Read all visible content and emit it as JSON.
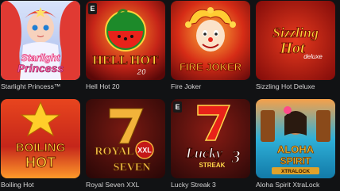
{
  "games": [
    {
      "id": "starlight-princess",
      "title": "Starlight Princess™",
      "art_text": [
        "Starlight",
        "Princess"
      ],
      "colors": {
        "bg": "#b9c9ef",
        "accent": "#e8357a"
      }
    },
    {
      "id": "hell-hot-20",
      "title": "Hell Hot 20",
      "art_text": [
        "HELL HOT",
        "20"
      ],
      "badge": "E",
      "colors": {
        "bg": "#c62518",
        "accent": "#ffd23a"
      }
    },
    {
      "id": "fire-joker",
      "title": "Fire Joker",
      "art_text": [
        "FIRE JOKER"
      ],
      "colors": {
        "bg": "#c91a16",
        "accent": "#ffc62e"
      }
    },
    {
      "id": "sizzling-hot-deluxe",
      "title": "Sizzling Hot Deluxe",
      "art_text": [
        "Sizzling",
        "Hot",
        "deluxe"
      ],
      "colors": {
        "bg": "#c11616",
        "accent": "#ffcf36"
      }
    },
    {
      "id": "boiling-hot",
      "title": "Boiling Hot",
      "art_text": [
        "BOILING",
        "HOT"
      ],
      "colors": {
        "bg": "#d4301b",
        "accent": "#ffc82a"
      }
    },
    {
      "id": "royal-seven-xxl",
      "title": "Royal Seven XXL",
      "art_text": [
        "ROYAL",
        "XXL",
        "SEVEN"
      ],
      "colors": {
        "bg": "#3b0b0b",
        "accent": "#f2b33a"
      }
    },
    {
      "id": "lucky-streak-3",
      "title": "Lucky Streak 3",
      "art_text": [
        "Lucky",
        "STREAK",
        "3"
      ],
      "badge": "E",
      "colors": {
        "bg": "#4a1010",
        "accent": "#ffd84a"
      }
    },
    {
      "id": "aloha-spirit-xtralock",
      "title": "Aloha Spirit XtraLock",
      "art_text": [
        "ALOHA",
        "SPIRIT",
        "XTRALOCK"
      ],
      "colors": {
        "bg": "#1c9fd0",
        "accent": "#ffd13a"
      }
    }
  ]
}
